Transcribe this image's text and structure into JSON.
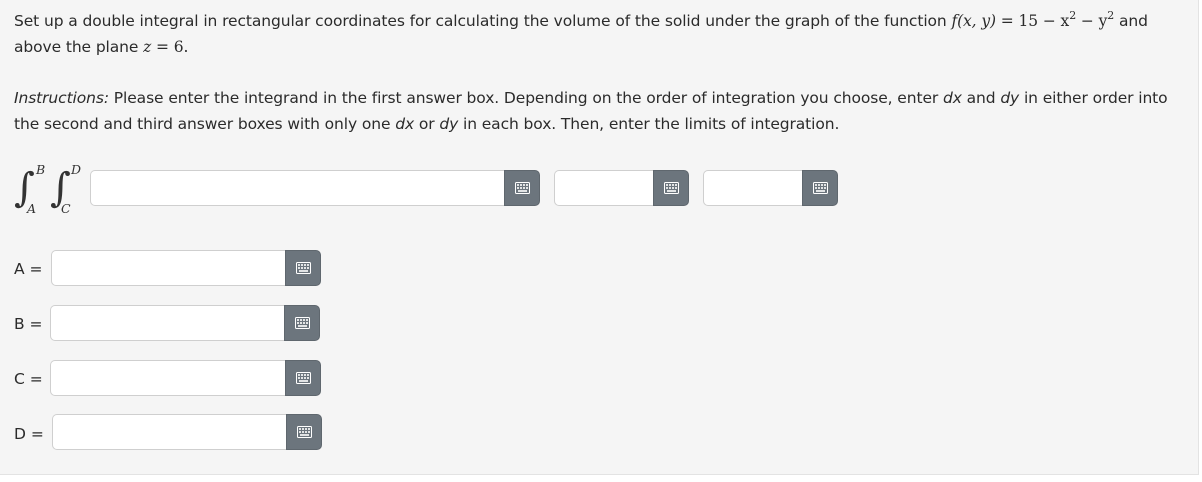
{
  "question": {
    "intro": "Set up a double integral in rectangular coordinates for calculating the volume of the solid under the graph of the function ",
    "function_math": "f(x, y)",
    "equals": " = 15 − x",
    "exp1": "2",
    "minus": " − y",
    "exp2": "2",
    "and_text": " and above the plane ",
    "plane_var": "z",
    "plane_eq": " = 6."
  },
  "instructions": {
    "label": "Instructions:",
    "text1": " Please enter the integrand in the first answer box. Depending on the order of integration you choose, enter ",
    "dx1": "dx",
    "text2": " and ",
    "dy1": "dy",
    "text3": " in either order into the second and third answer boxes with only one ",
    "dx2": "dx",
    "text4": " or ",
    "dy2": "dy",
    "text5": " in each box. Then, enter the limits of integration."
  },
  "integral": {
    "outer_upper": "B",
    "outer_lower": "A",
    "inner_upper": "D",
    "inner_lower": "C"
  },
  "answer_boxes": {
    "integrand_value": "",
    "differential1_value": "",
    "differential2_value": ""
  },
  "limits": [
    {
      "label": "A =",
      "value": ""
    },
    {
      "label": "B =",
      "value": ""
    },
    {
      "label": "C =",
      "value": ""
    },
    {
      "label": "D =",
      "value": ""
    }
  ],
  "icons": {
    "keyboard": "keyboard-icon"
  },
  "colors": {
    "button_bg": "#6c757d",
    "panel_bg": "#f5f5f5"
  }
}
